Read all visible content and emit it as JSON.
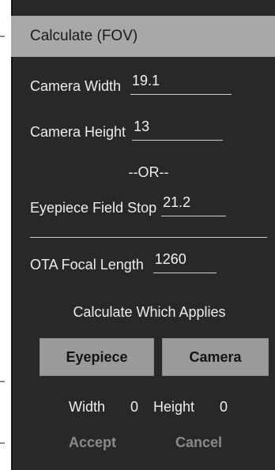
{
  "header": {
    "title": "Calculate (FOV)"
  },
  "fields": {
    "camera_width": {
      "label": "Camera Width",
      "value": "19.1"
    },
    "camera_height": {
      "label": "Camera Height",
      "value": "13"
    },
    "or_separator": "--OR--",
    "eyepiece_field_stop": {
      "label": "Eyepiece Field Stop",
      "value": "21.2"
    },
    "ota_focal_length": {
      "label": "OTA Focal Length",
      "value": "1260"
    }
  },
  "calculate_prompt": "Calculate Which Applies",
  "buttons": {
    "eyepiece": "Eyepiece",
    "camera": "Camera"
  },
  "results": {
    "width_label": "Width",
    "width_value": "0",
    "height_label": "Height",
    "height_value": "0"
  },
  "actions": {
    "accept": "Accept",
    "cancel": "Cancel"
  },
  "colors": {
    "panel_bg": "#282828",
    "header_bg": "#a8a8a8",
    "button_bg": "#9a9a9a",
    "disabled_text": "#8a8a8a"
  }
}
